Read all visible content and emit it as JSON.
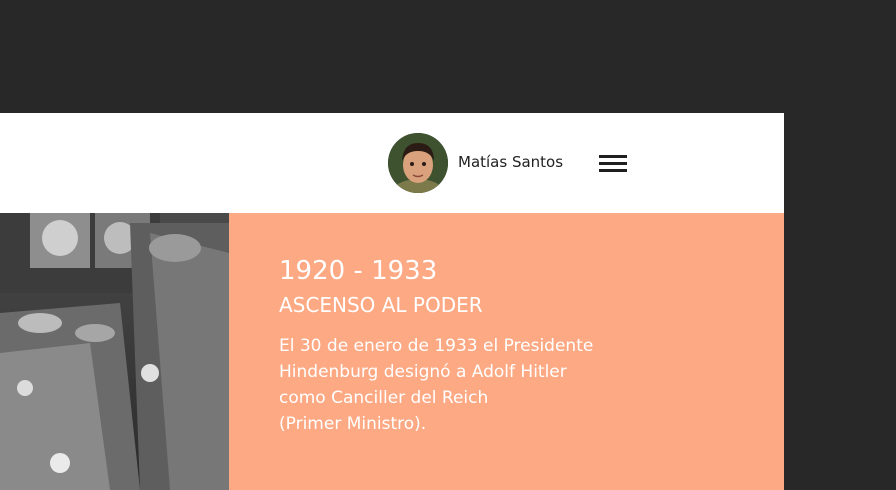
{
  "header": {
    "user_name": "Matías Santos",
    "avatar_icon": "user-avatar-photo",
    "menu_icon": "hamburger-menu-icon"
  },
  "hero": {
    "image": "historical-photo-grayscale"
  },
  "panel": {
    "period": "1920 - 1933",
    "title": "ASCENSO AL PODER",
    "body_lines": [
      "El 30 de enero de 1933 el Presidente",
      "Hindenburg designó a Adolf Hitler",
      "como Canciller del Reich",
      "(Primer Ministro)."
    ],
    "background": "#fda984"
  },
  "colors": {
    "page_background": "#282828",
    "header_background": "#ffffff"
  }
}
